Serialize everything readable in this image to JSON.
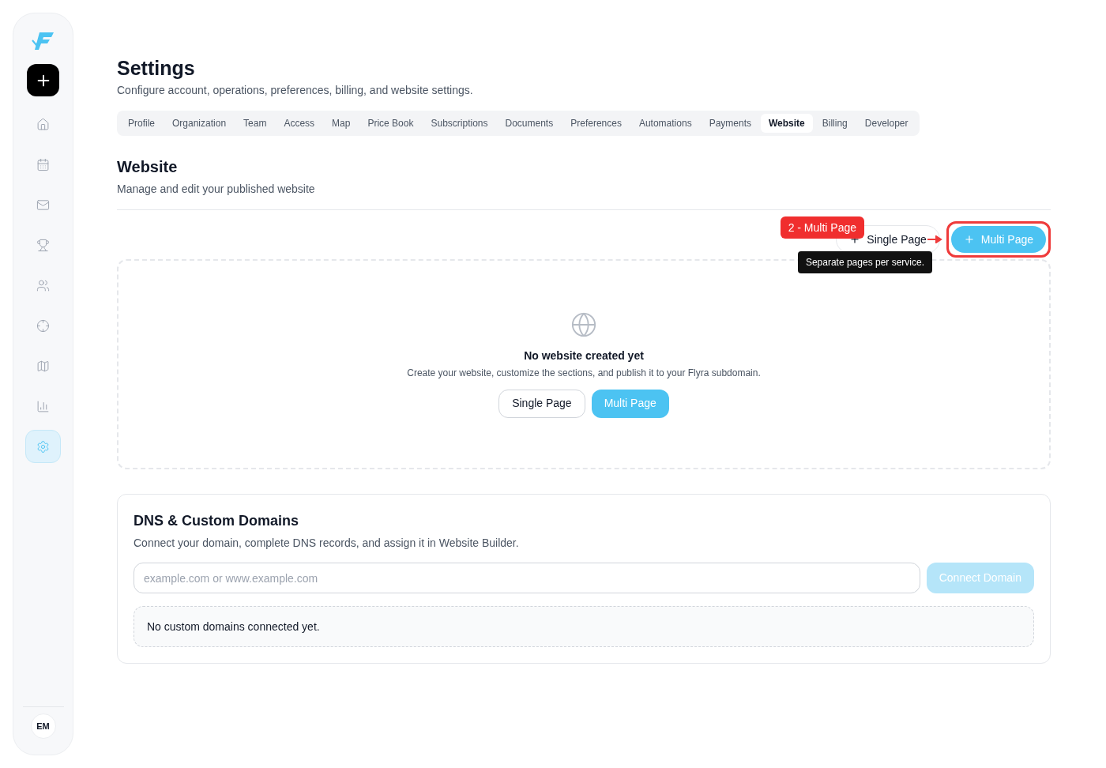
{
  "sidebar": {
    "items": [
      {
        "selected": false
      },
      {
        "selected": false
      },
      {
        "selected": false
      },
      {
        "selected": false
      },
      {
        "selected": false
      },
      {
        "selected": false
      },
      {
        "selected": false
      },
      {
        "selected": false
      },
      {
        "selected": true
      }
    ],
    "avatar": "EM"
  },
  "header": {
    "title": "Settings",
    "subtitle": "Configure account, operations, preferences, billing, and website settings."
  },
  "tabs": [
    {
      "label": "Profile",
      "selected": false
    },
    {
      "label": "Organization",
      "selected": false
    },
    {
      "label": "Team",
      "selected": false
    },
    {
      "label": "Access",
      "selected": false
    },
    {
      "label": "Map",
      "selected": false
    },
    {
      "label": "Price Book",
      "selected": false
    },
    {
      "label": "Subscriptions",
      "selected": false
    },
    {
      "label": "Documents",
      "selected": false
    },
    {
      "label": "Preferences",
      "selected": false
    },
    {
      "label": "Automations",
      "selected": false
    },
    {
      "label": "Payments",
      "selected": false
    },
    {
      "label": "Website",
      "selected": true
    },
    {
      "label": "Billing",
      "selected": false
    },
    {
      "label": "Developer",
      "selected": false
    }
  ],
  "website": {
    "title": "Website",
    "subtitle": "Manage and edit your published website",
    "actions": [
      "Single Page",
      "Multi Page"
    ],
    "annotation": {
      "badge": "2 - Multi Page",
      "tooltip": "Separate pages per service."
    },
    "empty": {
      "title": "No website created yet",
      "text": "Create your website, customize the sections, and publish it to your Flyra subdomain.",
      "buttons": [
        "Single Page",
        "Multi Page"
      ]
    }
  },
  "dns": {
    "title": "DNS & Custom Domains",
    "subtitle": "Connect your domain, complete DNS records, and assign it in Website Builder.",
    "placeholder": "example.com or www.example.com",
    "button": "Connect Domain",
    "disabled": true,
    "empty": "No custom domains connected yet."
  }
}
